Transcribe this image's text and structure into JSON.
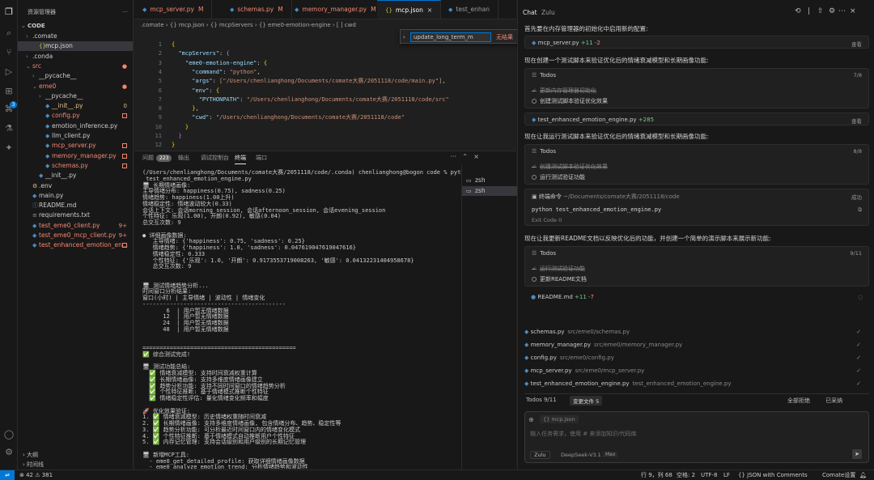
{
  "explorer": {
    "title": "资源管理器",
    "root": "CODE",
    "items": [
      {
        "label": ".comate",
        "indent": 1,
        "kind": "folder",
        "open": false,
        "status": ""
      },
      {
        "label": "mcp.json",
        "indent": 2,
        "kind": "json",
        "status": "",
        "selected": true
      },
      {
        "label": ".conda",
        "indent": 1,
        "kind": "folder",
        "open": false,
        "status": ""
      },
      {
        "label": "src",
        "indent": 1,
        "kind": "folder",
        "open": true,
        "status": "dot"
      },
      {
        "label": "__pycache__",
        "indent": 2,
        "kind": "folder",
        "open": false,
        "status": ""
      },
      {
        "label": "eme0",
        "indent": 2,
        "kind": "folder",
        "open": true,
        "status": "dot"
      },
      {
        "label": "__pycache__",
        "indent": 3,
        "kind": "folder",
        "open": false,
        "status": ""
      },
      {
        "label": "__init__.py",
        "indent": 3,
        "kind": "py",
        "status": "0"
      },
      {
        "label": "config.py",
        "indent": 3,
        "kind": "py",
        "status": "sq"
      },
      {
        "label": "emotion_inference.py",
        "indent": 3,
        "kind": "py",
        "status": ""
      },
      {
        "label": "llm_client.py",
        "indent": 3,
        "kind": "py",
        "status": ""
      },
      {
        "label": "mcp_server.py",
        "indent": 3,
        "kind": "py",
        "status": "sq"
      },
      {
        "label": "memory_manager.py",
        "indent": 3,
        "kind": "py",
        "status": "sq"
      },
      {
        "label": "schemas.py",
        "indent": 3,
        "kind": "py",
        "status": "sq"
      },
      {
        "label": "__init__.py",
        "indent": 2,
        "kind": "py",
        "status": ""
      },
      {
        "label": ".env",
        "indent": 1,
        "kind": "env",
        "status": ""
      },
      {
        "label": "main.py",
        "indent": 1,
        "kind": "py",
        "status": ""
      },
      {
        "label": "README.md",
        "indent": 1,
        "kind": "md",
        "status": ""
      },
      {
        "label": "requirements.txt",
        "indent": 1,
        "kind": "txt",
        "status": ""
      },
      {
        "label": "test_eme0_client.py",
        "indent": 1,
        "kind": "py",
        "status": "9+"
      },
      {
        "label": "test_eme0_mcp_client.py",
        "indent": 1,
        "kind": "py",
        "status": "9+"
      },
      {
        "label": "test_enhanced_emotion_en...",
        "indent": 1,
        "kind": "py",
        "status": "sq"
      }
    ],
    "outline_label": "大纲",
    "timeline_label": "时间线"
  },
  "tabs": [
    {
      "label": "mcp_server.py",
      "status": "M",
      "active": false
    },
    {
      "label": "schemas.py",
      "status": "M",
      "active": false
    },
    {
      "label": "memory_manager.py",
      "status": "M",
      "active": false
    },
    {
      "label": "mcp.json",
      "status": "×",
      "active": true
    },
    {
      "label": "test_enhan",
      "status": "",
      "active": false
    }
  ],
  "breadcrumb": ".comate  ›  {} mcp.json  ›  {} mcpServers  ›  {} eme0-emotion-engine  ›  [ ] cwd",
  "find": {
    "value": "update_long_term_m",
    "no_results": "无结果",
    "aa": "Aa",
    "ab": "ab",
    "re": ".*"
  },
  "code": [
    {
      "n": "1",
      "parts": [
        [
          "p",
          "{"
        ]
      ]
    },
    {
      "n": "2",
      "parts": [
        [
          "pl",
          "  "
        ],
        [
          "k",
          "\"mcpServers\""
        ],
        [
          "pl",
          ": "
        ],
        [
          "pu",
          "{"
        ]
      ]
    },
    {
      "n": "3",
      "parts": [
        [
          "pl",
          "    "
        ],
        [
          "k",
          "\"eme0-emotion-engine\""
        ],
        [
          "pl",
          ": "
        ],
        [
          "p",
          "{"
        ]
      ]
    },
    {
      "n": "4",
      "parts": [
        [
          "pl",
          "      "
        ],
        [
          "k",
          "\"command\""
        ],
        [
          "pl",
          ": "
        ],
        [
          "s",
          "\"python\""
        ],
        [
          "pl",
          ","
        ]
      ]
    },
    {
      "n": "5",
      "parts": [
        [
          "pl",
          "      "
        ],
        [
          "k",
          "\"args\""
        ],
        [
          "pl",
          ": "
        ],
        [
          "s",
          "[\"/Users/chenlianghong/Documents/comate大赛/2051118/code/main.py\"]"
        ],
        [
          "pl",
          ","
        ]
      ]
    },
    {
      "n": "6",
      "parts": [
        [
          "pl",
          "      "
        ],
        [
          "k",
          "\"env\""
        ],
        [
          "pl",
          ": "
        ],
        [
          "p",
          "{"
        ]
      ]
    },
    {
      "n": "7",
      "parts": [
        [
          "pl",
          "        "
        ],
        [
          "k",
          "\"PYTHONPATH\""
        ],
        [
          "pl",
          ": "
        ],
        [
          "s",
          "\"/Users/chenlianghong/Documents/comate大赛/2051118/code/src\""
        ]
      ]
    },
    {
      "n": "8",
      "parts": [
        [
          "pl",
          "      "
        ],
        [
          "p",
          "}"
        ],
        [
          "pl",
          ","
        ]
      ]
    },
    {
      "n": "9",
      "parts": [
        [
          "pl",
          "      "
        ],
        [
          "k",
          "\"cwd\""
        ],
        [
          "pl",
          ": "
        ],
        [
          "s",
          "\"/Users/chenlianghong/Documents/comate大赛/2051118/code\""
        ]
      ]
    },
    {
      "n": "10",
      "parts": [
        [
          "pl",
          "    "
        ],
        [
          "p",
          "}"
        ]
      ]
    },
    {
      "n": "11",
      "parts": [
        [
          "pl",
          "  "
        ],
        [
          "pu",
          "}"
        ]
      ]
    },
    {
      "n": "12",
      "parts": [
        [
          "p",
          "}"
        ]
      ]
    }
  ],
  "panel_tabs": [
    {
      "label": "问题",
      "count": "223",
      "active": false
    },
    {
      "label": "输出",
      "count": "",
      "active": false
    },
    {
      "label": "调试控制台",
      "count": "",
      "active": false
    },
    {
      "label": "终端",
      "count": "",
      "active": true
    },
    {
      "label": "端口",
      "count": "",
      "active": false
    }
  ],
  "terminal_lines": [
    "(/Users/chenlianghong/Documents/comate大赛/2051118/code/.conda) chenlianghong@bogon code % python",
    " test_enhanced_emotion_engine.py",
    "🖥 长期情绪画像:",
    "主导情绪分布: happiness(0.75), sadness(0.25)",
    "情绪趋势: happiness(1.00上升)",
    "情绪稳定性: 情绪波动较大(0.33)",
    "会话上下文: 会话morning_session, 会话afternoon_session, 会话evening_session",
    "个性特征: 乐观(1.00), 开朗(0.92), 敏感(0.04)",
    "总交互次数: 9",
    "",
    "● 详细画像数据:",
    "   主导情绪: {'happiness': 0.75, 'sadness': 0.25}",
    "   情绪趋势: {'happiness': 1.0, 'sadness': 0.047619047619047616}",
    "   情绪稳定性: 0.333",
    "   个性特征: {'乐观': 1.0, '开朗': 0.9173553719008263, '敏感': 0.04132231404958678}",
    "   总交互次数: 9",
    "",
    "",
    "🖥 测试情绪趋势分析...",
    "时间窗口分析结果:",
    "窗口(小时) | 主导情绪 | 波动性 | 情绪变化",
    "------------------------------------------",
    "       6  | 用户暂无情绪数据",
    "      12  | 用户暂无情绪数据",
    "      24  | 用户暂无情绪数据",
    "      48  | 用户暂无情绪数据",
    "",
    "",
    "=============================================",
    "✅ 综合测试完成!",
    "",
    "🖥 测试功能总结:",
    "  ✅ 情绪衰减模型: 支持时间衰减权重计算",
    "  ✅ 长期情绪画像: 支持多维度情绪画像建立",
    "  ✅ 趋势分析功能: 支持不同时间窗口的情绪趋势分析",
    "  ✅ 个性特征推断: 基于情绪模式推断个性特征",
    "  ✅ 情绪稳定性评估: 量化情绪变化频率和幅度",
    "",
    "🚀 优化效果验证:",
    "1. ✅ 情绪衰减模型: 历史情绪权重随时间衰减",
    "2. ✅ 长期情绪画像: 支持多维度情绪画像, 包含情绪分布、趋势、稳定性等",
    "3. ✅ 趋势分析功能: 可分析最近时间窗口内的情绪变化模式",
    "4. ✅ 个性特征推断: 基于情绪模式自动推断用户个性特征",
    "5. ✅ 内存记忆管理: 支持会话级别和用户级别的长期记忆管理",
    "",
    "🖥 新增MCP工具:",
    "  - eme0_get_detailed_profile: 获取详细情绪画像数据",
    "  - eme0_analyze_emotion_trend: 分析情绪趋势和波动性",
    "(/Users/chenlianghong/Documents/comate大赛/2051118/code/.conda) chenlianghong@bogon code % █"
  ],
  "terminal_list": [
    {
      "label": "zsh",
      "active": false
    },
    {
      "label": "zsh",
      "active": true
    }
  ],
  "chat": {
    "tabs": [
      {
        "label": "Chat",
        "active": true
      },
      {
        "label": "Zulu",
        "active": false
      }
    ],
    "header_icons": [
      "history-icon",
      "settings-icon",
      "more-icon",
      "close-icon"
    ],
    "msg1": "首先要在内存管理器的初始化中启用新的配置:",
    "file1": {
      "name": "mcp_server.py",
      "add": "+11",
      "del": "-2",
      "action": "查看"
    },
    "msg2": "现在创建一个测试脚本来验证优化后的情绪衰减模型和长期画像功能:",
    "todos1": {
      "title": "Todos",
      "count": "7/8",
      "items": [
        "更新内存管理器初始化",
        "创建测试脚本验证优化效果"
      ]
    },
    "file2": {
      "name": "test_enhanced_emotion_engine.py",
      "add": "+285",
      "action": "查看"
    },
    "msg3": "现在让我运行测试脚本来验证优化后的情绪衰减模型和长期画像功能:",
    "todos2": {
      "title": "Todos",
      "count": "8/8",
      "items": [
        "创建测试脚本验证优化效果",
        "运行测试验证功能"
      ]
    },
    "cmd": {
      "label": "终端命令",
      "path": "~/Documents/comate大赛/2051118/code",
      "status": "成功",
      "command": "python test_enhanced_emotion_engine.py",
      "exit": "Exit Code 0"
    },
    "msg4": "现在让我更新README文档以反映优化后的功能，并创建一个简单的演示脚本来展示新功能:",
    "todos3": {
      "title": "Todos",
      "count": "9/11",
      "items": [
        "运行测试验证功能",
        "更新README文档"
      ]
    },
    "file3": {
      "name": "README.md",
      "add": "+11",
      "del": "-7"
    },
    "changed_files": [
      {
        "name": "schemas.py",
        "path": "src/eme0/schemas.py"
      },
      {
        "name": "memory_manager.py",
        "path": "src/eme0/memory_manager.py"
      },
      {
        "name": "config.py",
        "path": "src/eme0/config.py"
      },
      {
        "name": "mcp_server.py",
        "path": "src/eme0/mcp_server.py"
      },
      {
        "name": "test_enhanced_emotion_engine.py",
        "path": "test_enhanced_emotion_engine.py"
      }
    ],
    "todo_footer": {
      "label": "Todos 9/11",
      "files_badge": "变更文件 5",
      "reject": "全部拒绝",
      "accept": "已采纳"
    },
    "input": {
      "chip": "{} mcp.json",
      "placeholder": "输入任务需求，使用 # 来添加知识/代码库",
      "mode": "Zulu",
      "model": "DeepSeek-V3.1",
      "model_badge": "Max"
    }
  },
  "status": {
    "errors": "⊗ 42 ⚠ 381",
    "position": "行 9，列 68",
    "spaces": "空格: 2",
    "encoding": "UTF-8",
    "eol": "LF",
    "language": "{} JSON with Comments",
    "comate": "Comate设置"
  }
}
